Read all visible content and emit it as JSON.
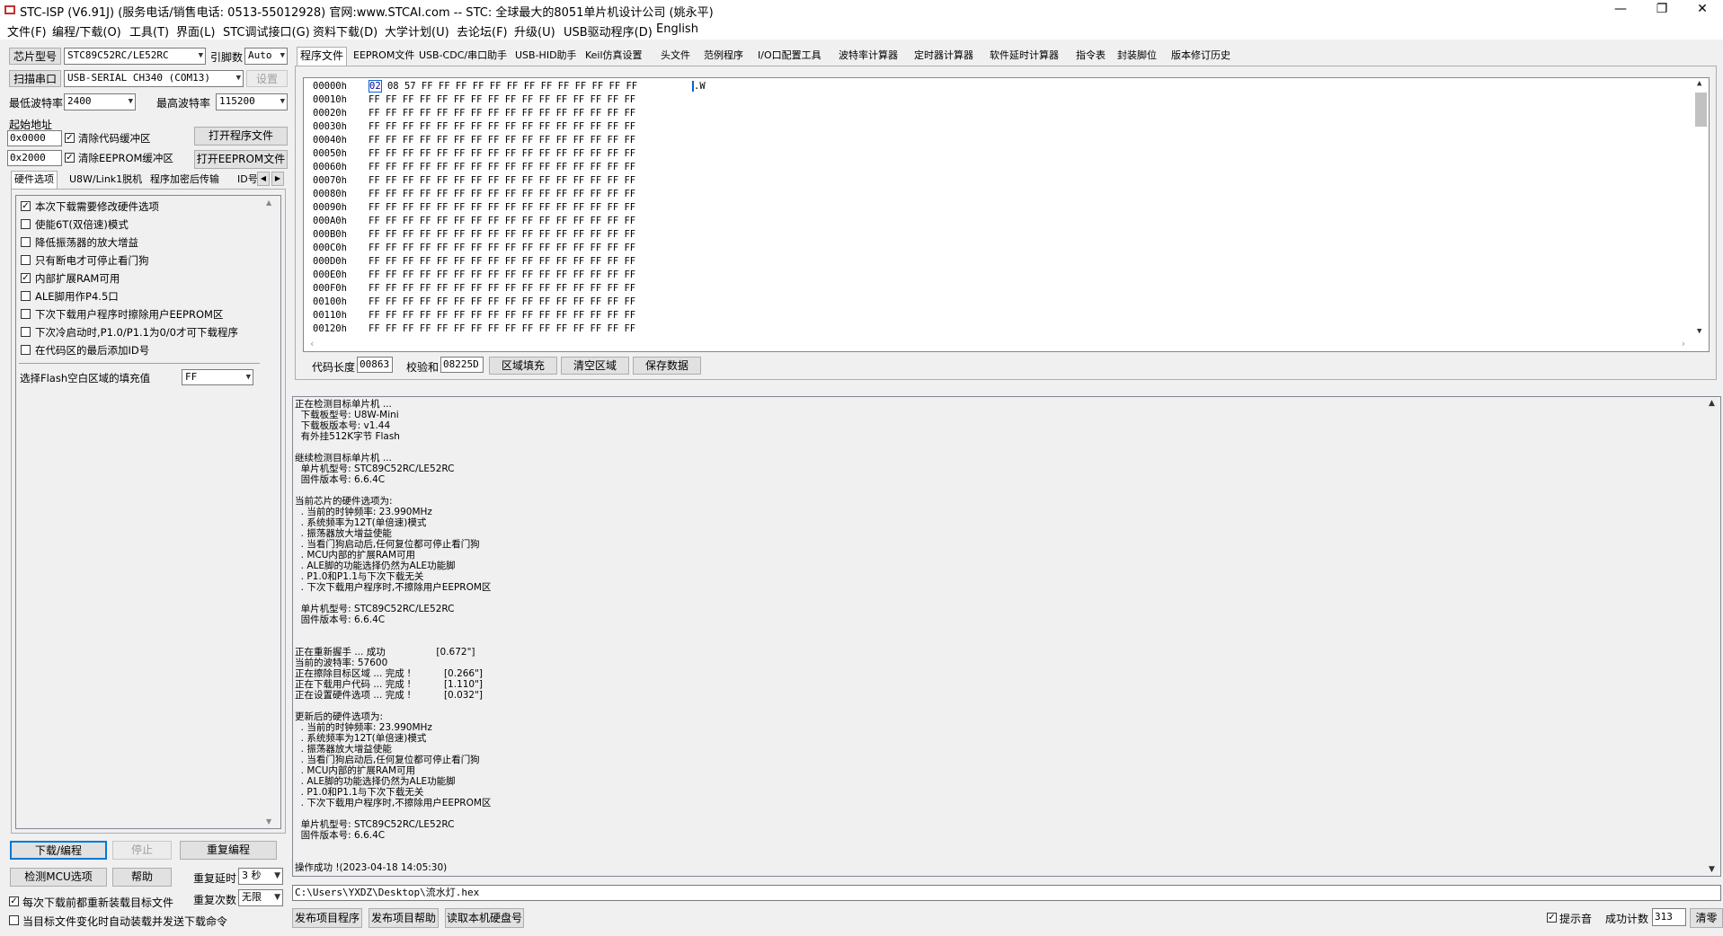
{
  "window": {
    "title": "STC-ISP (V6.91J) (服务电话/销售电话: 0513-55012928) 官网:www.STCAI.com  -- STC: 全球最大的8051单片机设计公司 (姚永平)",
    "minimize": "—",
    "restore": "❐",
    "close": "✕"
  },
  "menu": [
    "文件(F)",
    "编程/下载(O)",
    "工具(T)",
    "界面(L)",
    "STC调试接口(G)",
    "资料下载(D)",
    "大学计划(U)",
    "去论坛(F)",
    "升级(U)",
    "USB驱动程序(D)",
    "English"
  ],
  "left": {
    "chip_btn": "芯片型号",
    "chip_value": "STC89C52RC/LE52RC",
    "pins_label": "引脚数",
    "pins_value": "Auto",
    "scan_btn": "扫描串口",
    "port_value": "USB-SERIAL CH340 (COM13)",
    "settings_btn": "设置",
    "min_baud_label": "最低波特率",
    "min_baud_value": "2400",
    "max_baud_label": "最高波特率",
    "max_baud_value": "115200",
    "start_addr_label": "起始地址",
    "addr1": "0x0000",
    "clear_code_label": "清除代码缓冲区",
    "open_prog_btn": "打开程序文件",
    "addr2": "0x2000",
    "clear_eeprom_label": "清除EEPROM缓冲区",
    "open_eeprom_btn": "打开EEPROM文件",
    "tabs": [
      "硬件选项",
      "U8W/Link1脱机",
      "程序加密后传输",
      "ID号"
    ],
    "hw_items": [
      {
        "label": "本次下载需要修改硬件选项",
        "checked": true
      },
      {
        "label": "使能6T(双倍速)模式",
        "checked": false
      },
      {
        "label": "降低振荡器的放大增益",
        "checked": false
      },
      {
        "label": "只有断电才可停止看门狗",
        "checked": false
      },
      {
        "label": "内部扩展RAM可用",
        "checked": true
      },
      {
        "label": "ALE脚用作P4.5口",
        "checked": false
      },
      {
        "label": "下次下载用户程序时擦除用户EEPROM区",
        "checked": false
      },
      {
        "label": "下次冷启动时,P1.0/P1.1为0/0才可下载程序",
        "checked": false
      },
      {
        "label": "在代码区的最后添加ID号",
        "checked": false
      }
    ],
    "fill_label": "选择Flash空白区域的填充值",
    "fill_value": "FF",
    "download_btn": "下载/编程",
    "stop_btn": "停止",
    "reprogram_btn": "重复编程",
    "detect_btn": "检测MCU选项",
    "help_btn": "帮助",
    "repeat_delay_label": "重复延时",
    "repeat_delay_value": "3 秒",
    "reload_label": "每次下载前都重新装载目标文件",
    "repeat_count_label": "重复次数",
    "repeat_count_value": "无限",
    "auto_send_label": "当目标文件变化时自动装载并发送下载命令"
  },
  "top_tabs": [
    "程序文件",
    "EEPROM文件",
    "USB-CDC/串口助手",
    "USB-HID助手",
    "Keil仿真设置",
    "头文件",
    "范例程序",
    "I/O口配置工具",
    "波特率计算器",
    "定时器计算器",
    "软件延时计算器",
    "指令表",
    "封装脚位",
    "版本修订历史"
  ],
  "hex": {
    "rows": [
      {
        "addr": "00000h",
        "first": "02",
        "rest": " 08 57 FF FF FF FF FF FF FF FF FF FF FF FF FF",
        "ascii": ".W"
      },
      {
        "addr": "00010h",
        "first": "",
        "rest": "FF FF FF FF FF FF FF FF FF FF FF FF FF FF FF FF",
        "ascii": ""
      },
      {
        "addr": "00020h",
        "first": "",
        "rest": "FF FF FF FF FF FF FF FF FF FF FF FF FF FF FF FF",
        "ascii": ""
      },
      {
        "addr": "00030h",
        "first": "",
        "rest": "FF FF FF FF FF FF FF FF FF FF FF FF FF FF FF FF",
        "ascii": ""
      },
      {
        "addr": "00040h",
        "first": "",
        "rest": "FF FF FF FF FF FF FF FF FF FF FF FF FF FF FF FF",
        "ascii": ""
      },
      {
        "addr": "00050h",
        "first": "",
        "rest": "FF FF FF FF FF FF FF FF FF FF FF FF FF FF FF FF",
        "ascii": ""
      },
      {
        "addr": "00060h",
        "first": "",
        "rest": "FF FF FF FF FF FF FF FF FF FF FF FF FF FF FF FF",
        "ascii": ""
      },
      {
        "addr": "00070h",
        "first": "",
        "rest": "FF FF FF FF FF FF FF FF FF FF FF FF FF FF FF FF",
        "ascii": ""
      },
      {
        "addr": "00080h",
        "first": "",
        "rest": "FF FF FF FF FF FF FF FF FF FF FF FF FF FF FF FF",
        "ascii": ""
      },
      {
        "addr": "00090h",
        "first": "",
        "rest": "FF FF FF FF FF FF FF FF FF FF FF FF FF FF FF FF",
        "ascii": ""
      },
      {
        "addr": "000A0h",
        "first": "",
        "rest": "FF FF FF FF FF FF FF FF FF FF FF FF FF FF FF FF",
        "ascii": ""
      },
      {
        "addr": "000B0h",
        "first": "",
        "rest": "FF FF FF FF FF FF FF FF FF FF FF FF FF FF FF FF",
        "ascii": ""
      },
      {
        "addr": "000C0h",
        "first": "",
        "rest": "FF FF FF FF FF FF FF FF FF FF FF FF FF FF FF FF",
        "ascii": ""
      },
      {
        "addr": "000D0h",
        "first": "",
        "rest": "FF FF FF FF FF FF FF FF FF FF FF FF FF FF FF FF",
        "ascii": ""
      },
      {
        "addr": "000E0h",
        "first": "",
        "rest": "FF FF FF FF FF FF FF FF FF FF FF FF FF FF FF FF",
        "ascii": ""
      },
      {
        "addr": "000F0h",
        "first": "",
        "rest": "FF FF FF FF FF FF FF FF FF FF FF FF FF FF FF FF",
        "ascii": ""
      },
      {
        "addr": "00100h",
        "first": "",
        "rest": "FF FF FF FF FF FF FF FF FF FF FF FF FF FF FF FF",
        "ascii": ""
      },
      {
        "addr": "00110h",
        "first": "",
        "rest": "FF FF FF FF FF FF FF FF FF FF FF FF FF FF FF FF",
        "ascii": ""
      },
      {
        "addr": "00120h",
        "first": "",
        "rest": "FF FF FF FF FF FF FF FF FF FF FF FF FF FF FF FF",
        "ascii": ""
      }
    ],
    "code_len_label": "代码长度",
    "code_len_value": "00863",
    "checksum_label": "校验和",
    "checksum_value": "08225D",
    "fill_btn": "区域填充",
    "clear_btn": "清空区域",
    "save_btn": "保存数据"
  },
  "log": "正在检测目标单片机 ...\n  下载板型号: U8W-Mini\n  下载板版本号: v1.44\n  有外挂512K字节 Flash\n\n继续检测目标单片机 ...\n  单片机型号: STC89C52RC/LE52RC\n  固件版本号: 6.6.4C\n\n当前芯片的硬件选项为:\n  . 当前的时钟频率: 23.990MHz\n  . 系统频率为12T(单倍速)模式\n  . 振荡器放大增益使能\n  . 当看门狗启动后,任何复位都可停止看门狗\n  . MCU内部的扩展RAM可用\n  . ALE脚的功能选择仍然为ALE功能脚\n  . P1.0和P1.1与下次下载无关\n  . 下次下载用户程序时,不擦除用户EEPROM区\n\n  单片机型号: STC89C52RC/LE52RC\n  固件版本号: 6.6.4C\n\n\n正在重新握手 ... 成功                 [0.672\"]\n当前的波特率: 57600\n正在擦除目标区域 ... 完成 !           [0.266\"]\n正在下载用户代码 ... 完成 !           [1.110\"]\n正在设置硬件选项 ... 完成 !           [0.032\"]\n\n更新后的硬件选项为:\n  . 当前的时钟频率: 23.990MHz\n  . 系统频率为12T(单倍速)模式\n  . 振荡器放大增益使能\n  . 当看门狗启动后,任何复位都可停止看门狗\n  . MCU内部的扩展RAM可用\n  . ALE脚的功能选择仍然为ALE功能脚\n  . P1.0和P1.1与下次下载无关\n  . 下次下载用户程序时,不擦除用户EEPROM区\n\n  单片机型号: STC89C52RC/LE52RC\n  固件版本号: 6.6.4C\n\n\n操作成功 !(2023-04-18 14:05:30)",
  "bottom": {
    "path": "C:\\Users\\YXDZ\\Desktop\\流水灯.hex",
    "publish_prog_btn": "发布项目程序",
    "publish_help_btn": "发布项目帮助",
    "read_disk_btn": "读取本机硬盘号",
    "sound_label": "提示音",
    "success_label": "成功计数",
    "success_value": "313",
    "clear_btn": "清零"
  }
}
